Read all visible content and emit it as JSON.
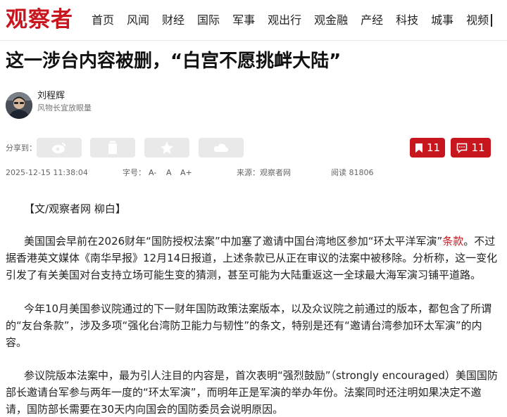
{
  "site": {
    "logo": "观察者"
  },
  "nav": [
    "首页",
    "风闻",
    "财经",
    "国际",
    "军事",
    "观出行",
    "观金融",
    "产经",
    "科技",
    "城事",
    "视频"
  ],
  "article": {
    "title": "这一涉台内容被删，“白宫不愿挑衅大陆”",
    "author": {
      "name": "刘程辉",
      "subtitle": "风物长宜放眼量"
    },
    "share_label": "分享到：",
    "share_icons": [
      "weibo-icon",
      "wechat-icon",
      "star-icon",
      "cloud-icon"
    ],
    "bookmark_count": "11",
    "comment_count": "11",
    "meta": {
      "datetime": "2025-12-15 11:38:04",
      "font_label": "字号：",
      "font_small": "A-",
      "font_normal": "A",
      "font_large": "A+",
      "source": "来源：观察者网",
      "views": "阅读 81806"
    },
    "byline": "【文/观察者网 柳白】",
    "p1_before": "美国国会早前在2026财年“国防授权法案”中加塞了邀请中国台湾地区参加“环太平洋军演”",
    "p1_link": "条款",
    "p1_after": "。不过据香港英文媒体《南华早报》12月14日报道，上述条款已从正在审议的法案中被移除。分析称，这一变化引发了有关美国对台支持立场可能生变的猜测，甚至可能为大陆重返这一全球最大海军演习铺平道路。",
    "p2": "今年10月美国参议院通过的下一财年国防政策法案版本，以及众议院之前通过的版本，都包含了所谓的“友台条款”，涉及多项“强化台湾防卫能力与韧性”的条文，特别是还有“邀请台湾参加环太军演”的内容。",
    "p3": "参议院版本法案中，最为引人注目的内容是，首次表明“强烈鼓励”（strongly encouraged）美国国防部长邀请台军参与两年一度的“环太军演”，而明年正是军演的举办年份。法案同时还注明如果决定不邀请，国防部长需要在30天内向国会的国防委员会说明原因。"
  },
  "colors": {
    "brand": "#c8161e",
    "share_bg": "#e9e9e9"
  }
}
